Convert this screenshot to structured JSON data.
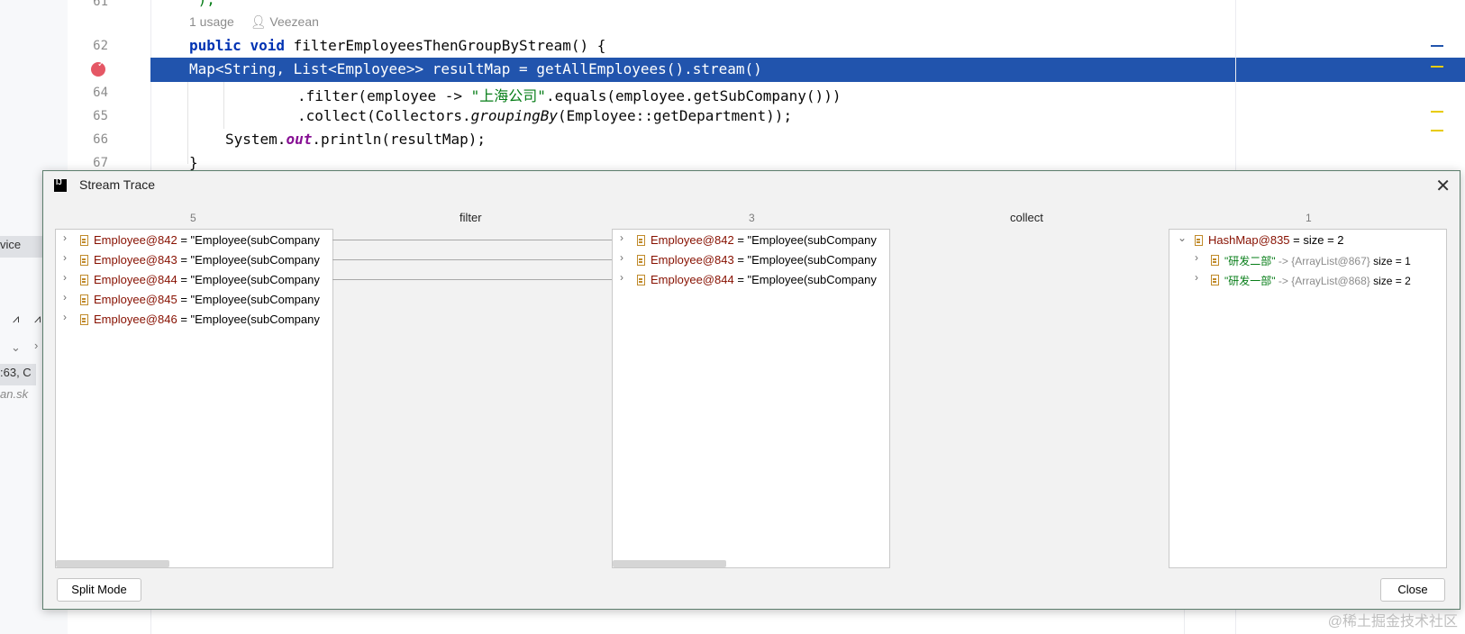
{
  "editor": {
    "usage_hint": "1 usage",
    "author": "Veezean",
    "partial_top": "\");",
    "lines": [
      {
        "no": "61",
        "top": "-8"
      },
      {
        "no": "62",
        "top": "42"
      },
      {
        "no": "64",
        "top": "94"
      },
      {
        "no": "65",
        "top": "120"
      },
      {
        "no": "66",
        "top": "146"
      },
      {
        "no": "67",
        "top": "172"
      }
    ],
    "code": {
      "l62_kw1": "public",
      "l62_kw2": "void",
      "l62_rest": " filterEmployeesThenGroupByStream() {",
      "l63": "Map<String, List<Employee>> resultMap = getAllEmployees().stream()",
      "l64_pre": ".filter(employee -> ",
      "l64_str": "\"上海公司\"",
      "l64_post": ".equals(employee.getSubCompany()))",
      "l65_pre": ".collect(Collectors.",
      "l65_it": "groupingBy",
      "l65_post": "(Employee::getDepartment));",
      "l66_pre": "System.",
      "l66_out": "out",
      "l66_post": ".println(resultMap);",
      "l67": "}"
    }
  },
  "left_fragments": {
    "f1": "vice",
    "f2": ":63, C",
    "f3": "an.sk"
  },
  "dialog": {
    "title": "Stream Trace",
    "close_icon": "close-icon",
    "columns": [
      {
        "count": "5"
      },
      {
        "count": "3"
      },
      {
        "count": "1"
      }
    ],
    "operations": [
      "filter",
      "collect"
    ],
    "col1_rows": [
      {
        "name": "Employee@842",
        "value": " = \"Employee(subCompany"
      },
      {
        "name": "Employee@843",
        "value": " = \"Employee(subCompany"
      },
      {
        "name": "Employee@844",
        "value": " = \"Employee(subCompany"
      },
      {
        "name": "Employee@845",
        "value": " = \"Employee(subCompany"
      },
      {
        "name": "Employee@846",
        "value": " = \"Employee(subCompany"
      }
    ],
    "col2_rows": [
      {
        "name": "Employee@842",
        "value": " = \"Employee(subCompany"
      },
      {
        "name": "Employee@843",
        "value": " = \"Employee(subCompany"
      },
      {
        "name": "Employee@844",
        "value": " = \"Employee(subCompany"
      }
    ],
    "result": {
      "root_name": "HashMap@835",
      "root_value": " =  size = 2",
      "children": [
        {
          "key": "\"研发二部\"",
          "arrow": " -> {ArrayList@867}",
          "size": "  size = 1"
        },
        {
          "key": "\"研发一部\"",
          "arrow": " -> {ArrayList@868}",
          "size": "  size = 2"
        }
      ]
    },
    "split_mode_label": "Split Mode",
    "close_label": "Close"
  },
  "watermark": "@稀土掘金技术社区",
  "colors": {
    "selection": "#2154ad",
    "breakpoint": "#e55765",
    "dialog_bg": "#f2f2f2"
  }
}
